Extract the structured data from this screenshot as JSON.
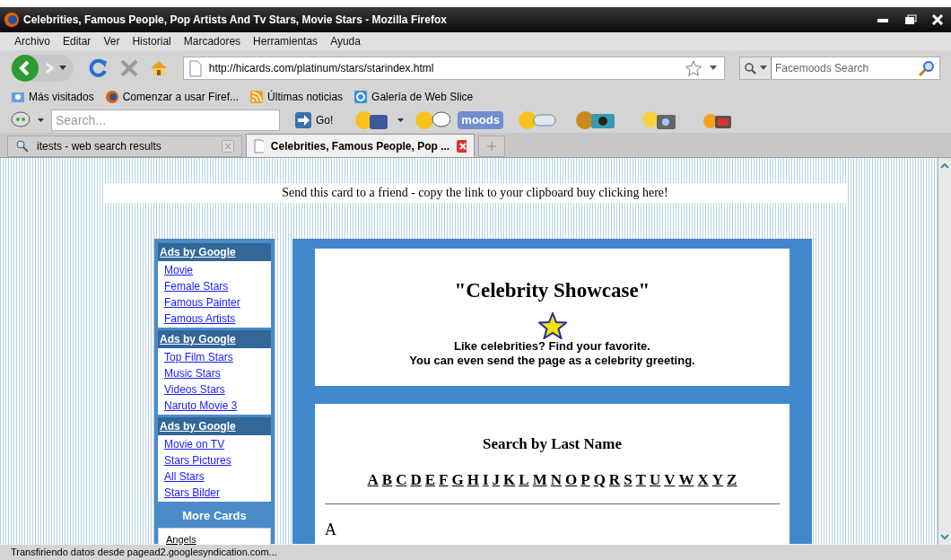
{
  "window": {
    "title": "Celebrities, Famous People, Pop Artists And Tv Stars, Movie Stars - Mozilla Firefox"
  },
  "menu": [
    "Archivo",
    "Editar",
    "Ver",
    "Historial",
    "Marcadores",
    "Herramientas",
    "Ayuda"
  ],
  "navigation": {
    "url": "http://hicards.com/platinum/stars/starindex.html",
    "search_placeholder": "Facemoods Search"
  },
  "bookmarks": [
    "Más visitados",
    "Comenzar a usar Firef...",
    "Últimas noticias",
    "Galería de Web Slice"
  ],
  "facemoods_toolbar": {
    "search_placeholder": "Search...",
    "go": "Go!",
    "moods": "moods"
  },
  "tabs": [
    {
      "label": "itests - web search results",
      "selected": false
    },
    {
      "label": "Celebrities, Famous People, Pop ...",
      "selected": true
    }
  ],
  "page": {
    "banner": "Send this card to a friend - copy the link to your clipboard buy clicking here!",
    "ad_groups": [
      {
        "header": "Ads by Google",
        "links": [
          "Movie",
          "Female Stars",
          "Famous Painter",
          "Famous Artists"
        ]
      },
      {
        "header": "Ads by Google",
        "links": [
          "Top Film Stars",
          "Music Stars",
          "Videos Stars",
          "Naruto Movie 3"
        ]
      },
      {
        "header": "Ads by Google",
        "links": [
          "Movie on TV",
          "Stars Pictures",
          "All Stars",
          "Stars Bilder"
        ]
      }
    ],
    "more_cards": {
      "title": "More Cards",
      "links": [
        "Angels"
      ]
    },
    "showcase": {
      "title": "\"Celebrity Showcase\"",
      "lines": [
        "Like celebrities? Find your favorite.",
        "You can even send the page as a celebrity greeting."
      ]
    },
    "search": {
      "heading": "Search by Last Name",
      "letters": [
        "A",
        "B",
        "C",
        "D",
        "E",
        "F",
        "G",
        "H",
        "I",
        "J",
        "K",
        "L",
        "M",
        "N",
        "O",
        "P",
        "Q",
        "R",
        "S",
        "T",
        "U",
        "V",
        "W",
        "X",
        "Y",
        "Z"
      ],
      "section": "A"
    }
  },
  "status_bar": "Transfiriendo datos desde pagead2.googlesyndication.com..."
}
